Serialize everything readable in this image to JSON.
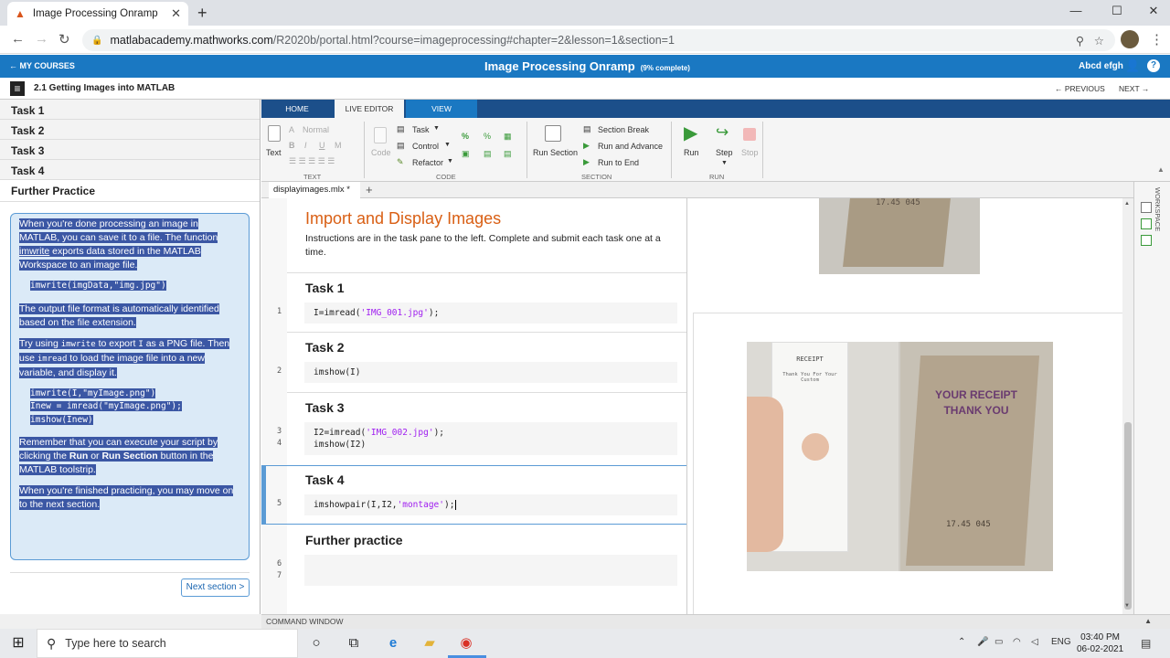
{
  "browser": {
    "tab_title": "Image Processing Onramp",
    "url_host": "matlabacademy.mathworks.com",
    "url_path": "/R2020b/portal.html?course=imageprocessing#chapter=2&lesson=1&section=1"
  },
  "header": {
    "back_label": "← MY COURSES",
    "course_title": "Image Processing Onramp",
    "progress": "(9% complete)",
    "user_name": "Abcd efgh"
  },
  "subheader": {
    "lesson_title": "2.1 Getting Images into MATLAB",
    "previous_label": "← PREVIOUS",
    "next_label": "NEXT →"
  },
  "task_list": [
    "Task 1",
    "Task 2",
    "Task 3",
    "Task 4",
    "Further Practice"
  ],
  "instructions": {
    "p1a": "When you're done processing an image in MATLAB, you can save it to a file. The function ",
    "p1_link": "imwrite",
    "p1b": " exports data stored in the MATLAB Workspace to an image file.",
    "code1": "imwrite(imgData,\"img.jpg\")",
    "p2": "The output file format is automatically identified based on the file extension.",
    "p3a": "Try using ",
    "p3_code1": "imwrite",
    "p3b": " to export ",
    "p3_code2": "I",
    "p3c": " as a PNG file. Then use ",
    "p3_code3": "imread",
    "p3d": " to load the image file into a new variable, and display it.",
    "code2_l1": "imwrite(I,\"myImage.png\")",
    "code2_l2": "Inew = imread(\"myImage.png\");",
    "code2_l3": "imshow(Inew)",
    "p4a": "Remember that you can execute your script by clicking the ",
    "p4_b1": "Run",
    "p4b": " or ",
    "p4_b2": "Run Section",
    "p4c": " button in the MATLAB toolstrip.",
    "p5": "When you're finished practicing, you may move on to the next section.",
    "next_section": "Next section >"
  },
  "toolstrip": {
    "tabs": [
      "HOME",
      "LIVE EDITOR",
      "VIEW"
    ],
    "text_btn": "Text",
    "normal": "Normal",
    "code_btn": "Code",
    "task": "Task",
    "control": "Control",
    "refactor": "Refactor",
    "run_section": "Run Section",
    "section_break": "Section Break",
    "run_and_advance": "Run and Advance",
    "run_to_end": "Run to End",
    "run": "Run",
    "step": "Step",
    "stop": "Stop",
    "groups": [
      "TEXT",
      "CODE",
      "SECTION",
      "RUN"
    ]
  },
  "editor": {
    "file_tab": "displayimages.mlx *",
    "heading": "Import and Display Images",
    "intro": "Instructions are in the task pane to the left. Complete and submit each task one at a time.",
    "task1": "Task 1",
    "task1_code_a": "I=imread(",
    "task1_code_str": "'IMG_001.jpg'",
    "task1_code_b": ");",
    "task2": "Task 2",
    "task2_code": "imshow(I)",
    "task3": "Task 3",
    "task3_code_a": "I2=imread(",
    "task3_code_str": "'IMG_002.jpg'",
    "task3_code_b": ");",
    "task3_code2": "imshow(I2)",
    "task4": "Task 4",
    "task4_code_a": "imshowpair(I,I2,",
    "task4_code_str": "'montage'",
    "task4_code_b": ");",
    "further": "Further practice",
    "line_numbers": [
      "1",
      "2",
      "3",
      "4",
      "5",
      "6",
      "7"
    ]
  },
  "output": {
    "receipt_heading": "RECEIPT",
    "receipt_thanks": "Thank You For Your Custom",
    "receipt2_line1": "YOUR RECEIPT",
    "receipt2_line2": "THANK YOU",
    "receipt2_total": "17.45 045"
  },
  "workspace_label": "WORKSPACE",
  "command_window": "COMMAND WINDOW",
  "taskbar": {
    "search_placeholder": "Type here to search",
    "lang": "ENG",
    "time": "03:40 PM",
    "date": "06-02-2021"
  },
  "colors": {
    "matlab_blue": "#1a78c2",
    "toolstrip_tab": "#1c4f8a",
    "heading_orange": "#d95f14",
    "selection": "#3b57a4",
    "string_purple": "#a020f0"
  }
}
